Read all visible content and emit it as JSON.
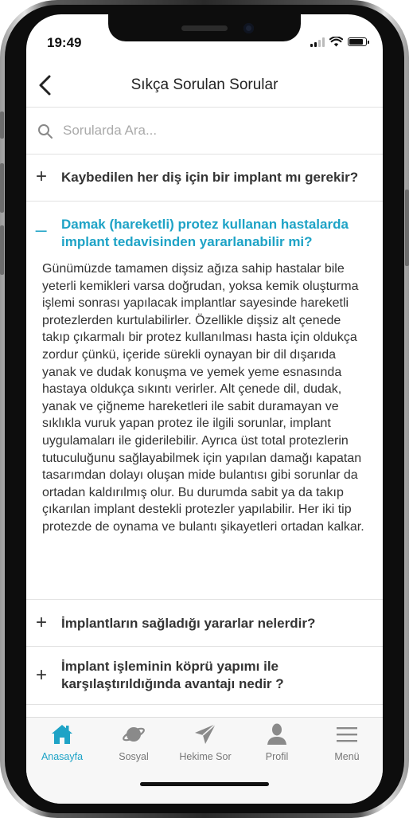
{
  "status_bar": {
    "time": "19:49",
    "battery_level": 0.85
  },
  "header": {
    "title": "Sıkça Sorulan Sorular"
  },
  "search": {
    "placeholder": "Sorularda Ara..."
  },
  "faq": [
    {
      "question": "Kaybedilen her diş için bir implant mı gerekir?",
      "expanded": false,
      "sign": "+"
    },
    {
      "question": "Damak (hareketli) protez kullanan hastalarda implant tedavisinden yararlanabilir mi?",
      "expanded": true,
      "sign": "_",
      "answer": "Günümüzde tamamen dişsiz ağıza sahip hastalar bile yeterli kemikleri varsa doğrudan, yoksa kemik oluşturma işlemi sonrası yapılacak implantlar sayesinde hareketli protezlerden kurtulabilirler. Özellikle dişsiz alt çenede takıp çıkarmalı bir protez kullanılması hasta için oldukça zordur çünkü, içeride sürekli oynayan bir dil dışarıda yanak ve dudak konuşma ve yemek yeme esnasında hastaya oldukça sıkıntı verirler. Alt çenede dil, dudak, yanak ve çiğneme hareketleri ile sabit duramayan ve sıklıkla vuruk yapan protez ile ilgili sorunlar, implant uygulamaları ile giderilebilir. Ayrıca üst total protezlerin tutuculuğunu sağlayabilmek için yapılan damağı kapatan tasarımdan dolayı oluşan mide bulantısı gibi sorunlar da ortadan kaldırılmış olur. Bu durumda sabit ya da takıp çıkarılan implant destekli protezler yapılabilir. Her iki tip protezde de oynama ve bulantı şikayetleri ortadan kalkar."
    },
    {
      "question": "İmplantların sağladığı yararlar nelerdir?",
      "expanded": false,
      "sign": "+"
    },
    {
      "question": "İmplant işleminin köprü yapımı ile karşılaştırıldığında avantajı nedir ?",
      "expanded": false,
      "sign": "+"
    }
  ],
  "tabbar": {
    "items": [
      {
        "label": "Anasayfa",
        "icon": "home-icon",
        "active": true
      },
      {
        "label": "Sosyal",
        "icon": "planet-icon",
        "active": false
      },
      {
        "label": "Hekime Sor",
        "icon": "paper-plane-icon",
        "active": false
      },
      {
        "label": "Profil",
        "icon": "person-icon",
        "active": false
      },
      {
        "label": "Menü",
        "icon": "hamburger-icon",
        "active": false
      }
    ]
  },
  "colors": {
    "accent": "#1ea3c6",
    "text": "#333333",
    "tab_inactive": "#777777",
    "divider": "#e2e2e2"
  }
}
